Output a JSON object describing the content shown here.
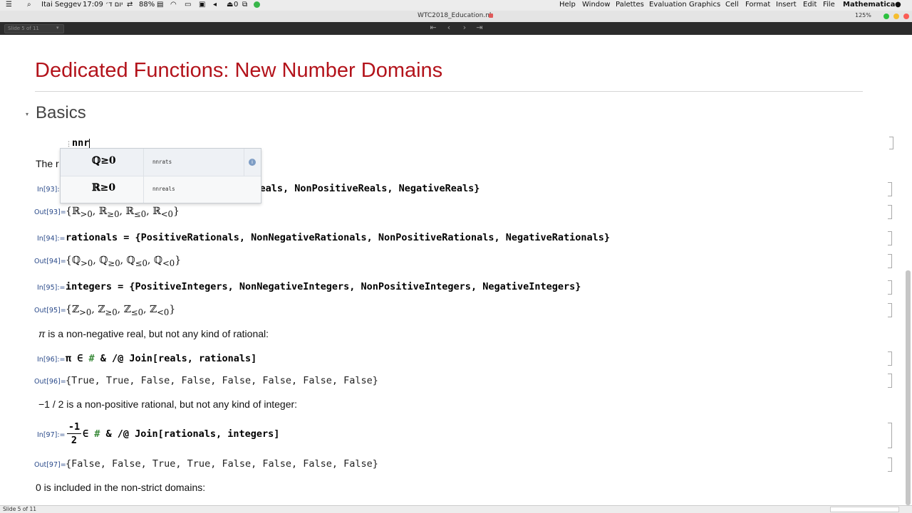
{
  "menubar": {
    "app_name": "Mathematica",
    "items": [
      "File",
      "Edit",
      "Insert",
      "Format",
      "Cell",
      "Graphics",
      "Evaluation",
      "Palettes",
      "Window",
      "Help"
    ],
    "status_left": [
      "Itai Seggev",
      "17:09 יום ד׳",
      "88%",
      "0"
    ]
  },
  "window": {
    "title": "WTC2018_Education.nb",
    "zoom": "125%"
  },
  "toolbar": {
    "slide_select": "Slide 5 of 11"
  },
  "notebook": {
    "title": "Dedicated Functions: New Number Domains",
    "section": "Basics",
    "typing_input": "nnr",
    "partial_text": "The r",
    "cells": [
      {
        "label": "In[93]:=",
        "code": "iveReals, NonPositiveReals, NegativeReals}"
      },
      {
        "label": "Out[93]=",
        "sym": "ℝ",
        "out": "{ℝ>0, ℝ≥0, ℝ≤0, ℝ<0}"
      },
      {
        "label": "In[94]:=",
        "code": "rationals = {PositiveRationals, NonNegativeRationals, NonPositiveRationals, NegativeRationals}"
      },
      {
        "label": "Out[94]=",
        "sym": "ℚ",
        "out": "{ℚ>0, ℚ≥0, ℚ≤0, ℚ<0}"
      },
      {
        "label": "In[95]:=",
        "code": "integers = {PositiveIntegers, NonNegativeIntegers, NonPositiveIntegers, NegativeIntegers}"
      },
      {
        "label": "Out[95]=",
        "sym": "ℤ",
        "out": "{ℤ>0, ℤ≥0, ℤ≤0, ℤ<0}"
      },
      {
        "label": "In[96]:=",
        "code_a": "π ∈ ",
        "code_hash": "#",
        "code_b": " & /@ Join[reals, rationals]"
      },
      {
        "label": "Out[96]=",
        "out": "{True, True, False, False, False, False, False, False}"
      },
      {
        "label": "In[97]:=",
        "frac_num": "-1",
        "frac_den": "2",
        "code_a": " ∈ ",
        "code_hash": "#",
        "code_b": " & /@ Join[rationals, integers]"
      },
      {
        "label": "Out[97]=",
        "out": "{False, False, True, True, False, False, False, False}"
      }
    ],
    "texts": {
      "pi_note_symbol": "π",
      "pi_note": " is a non-negative real, but not any kind of rational:",
      "half_note": "−1 / 2 is a non-positive rational, but not any kind of integer:",
      "zero_note": "0 is included in the non-strict domains:"
    }
  },
  "autocomplete": {
    "items": [
      {
        "symbol": "ℚ≥0",
        "name": "nnrats"
      },
      {
        "symbol": "ℝ≥0",
        "name": "nnreals"
      }
    ]
  },
  "statusbar": {
    "text": "Slide 5 of 11"
  }
}
